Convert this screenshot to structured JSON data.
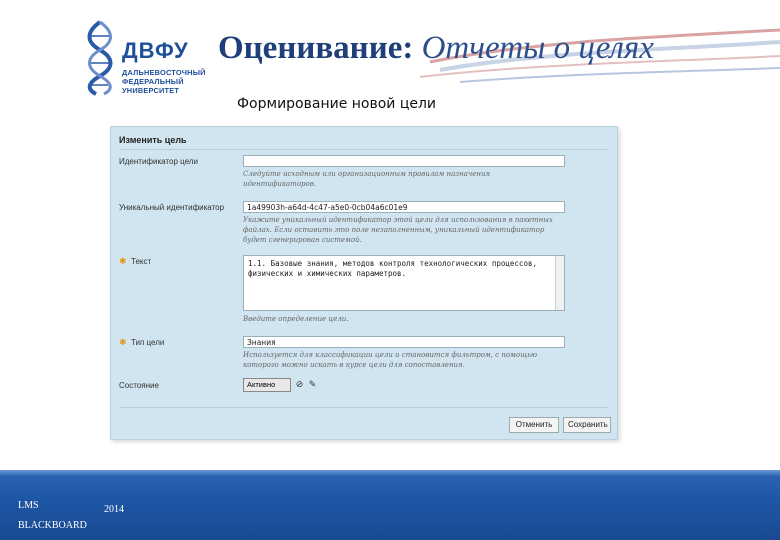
{
  "logo": {
    "abbr": "ДВФУ",
    "line1": "ДАЛЬНЕВОСТОЧНЫЙ",
    "line2": "ФЕДЕРАЛЬНЫЙ",
    "line3": "УНИВЕРСИТЕТ"
  },
  "header": {
    "title_bold": "Оценивание:",
    "title_light": " Отчеты о целях",
    "subtitle": "Формирование новой цели"
  },
  "form": {
    "title": "Изменить цель",
    "goal_id_label": "Идентификатор цели",
    "goal_id_value": "",
    "goal_id_hint": "Следуйте исходным или организационным правилам назначения идентификаторов.",
    "unique_id_label": "Уникальный идентификатор",
    "unique_id_value": "1a49903h-a64d-4c47-a5e0-0cb04a6c01e9",
    "unique_id_hint": "Укажите уникальный идентификатор этой цели для использования в пакетных файлах. Если оставить это поле незаполненным, уникальный идентификатор будет сгенерирован системой.",
    "text_label": "Текст",
    "text_value": "1.1. Базовые знания, методов контроля технологических процессов, физических и химических параметров.",
    "text_hint": "Введите определение цели.",
    "type_label": "Тип цели",
    "type_value": "Знания",
    "type_hint": "Используется для классификации цели и становится фильтром, с помощью которого можно искать в курсе цели для сопоставления.",
    "status_label": "Состояние",
    "status_value": "Активно",
    "cancel_label": "Отменить",
    "save_label": "Сохранить"
  },
  "footer": {
    "left_top": "LMS",
    "left_bottom": "BLACKBOARD",
    "year": "2014"
  },
  "colors": {
    "brand_blue": "#1f4e9a",
    "footer_blue": "#1f57a7",
    "panel_bg": "#d0e5ef",
    "required_star": "#e09a1c"
  }
}
